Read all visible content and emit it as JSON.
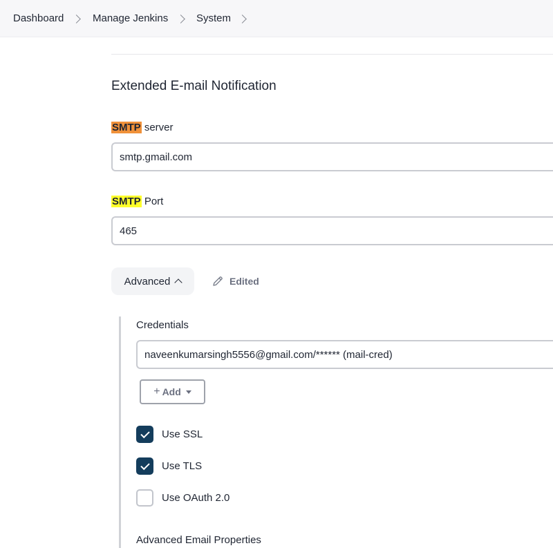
{
  "breadcrumb": {
    "items": [
      {
        "label": "Dashboard"
      },
      {
        "label": "Manage Jenkins"
      },
      {
        "label": "System"
      }
    ]
  },
  "section": {
    "title": "Extended E-mail Notification"
  },
  "smtp_server": {
    "label_highlight": "SMTP",
    "label_rest": " server",
    "value": "smtp.gmail.com"
  },
  "smtp_port": {
    "label_highlight": "SMTP",
    "label_rest": " Port",
    "value": "465"
  },
  "advanced": {
    "button_label": "Advanced",
    "edited_label": "Edited"
  },
  "credentials": {
    "label": "Credentials",
    "value": "naveenkumarsingh5556@gmail.com/****** (mail-cred)",
    "add_label": "Add"
  },
  "options": {
    "use_ssl": {
      "label": "Use SSL",
      "checked": true
    },
    "use_tls": {
      "label": "Use TLS",
      "checked": true
    },
    "use_oauth": {
      "label": "Use OAuth 2.0",
      "checked": false
    }
  },
  "advanced_email_properties": {
    "label": "Advanced Email Properties"
  },
  "colors": {
    "highlight_orange": "#f0913a",
    "highlight_yellow": "#ffff2b",
    "checkbox_checked": "#143d5c"
  }
}
